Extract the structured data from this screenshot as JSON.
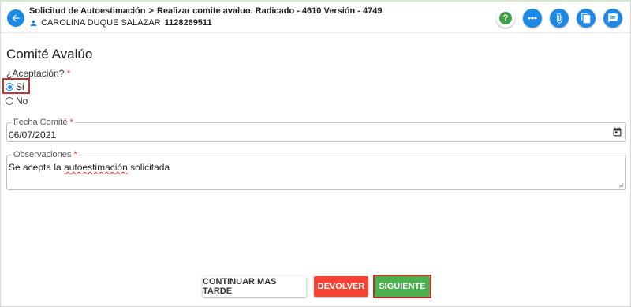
{
  "header": {
    "breadcrumb_1": "Solicitud de Autoestimación",
    "breadcrumb_separator": ">",
    "breadcrumb_2": "Realizar comite avaluo. Radicado - 4610 Versión - 4749",
    "user_name": "CAROLINA DUQUE SALAZAR",
    "user_doc": "1128269511",
    "icons": [
      "help-icon",
      "more-options-icon",
      "attachment-icon",
      "copy-icon",
      "notes-icon"
    ],
    "help_glyph": "?"
  },
  "form": {
    "title": "Comité Avalúo",
    "acceptance_label": "¿Aceptación?",
    "required_mark": "*",
    "options": [
      {
        "label": "Si",
        "checked": true
      },
      {
        "label": "No",
        "checked": false
      }
    ],
    "date_label": "Fecha Comité",
    "date_value": "06/07/2021",
    "obs_label": "Observaciones",
    "obs_value_prefix": "Se acepta la ",
    "obs_value_misspelled": "autoestimación",
    "obs_value_suffix": " solicitada"
  },
  "actions": {
    "later_label": "CONTINUAR MAS TARDE",
    "return_label": "DEVOLVER",
    "next_label": "SIGUIENTE"
  },
  "colors": {
    "primary": "#1e88e5",
    "help_green": "#43a047",
    "danger": "#f44336",
    "success": "#4caf50",
    "highlight": "#d32f2f"
  }
}
